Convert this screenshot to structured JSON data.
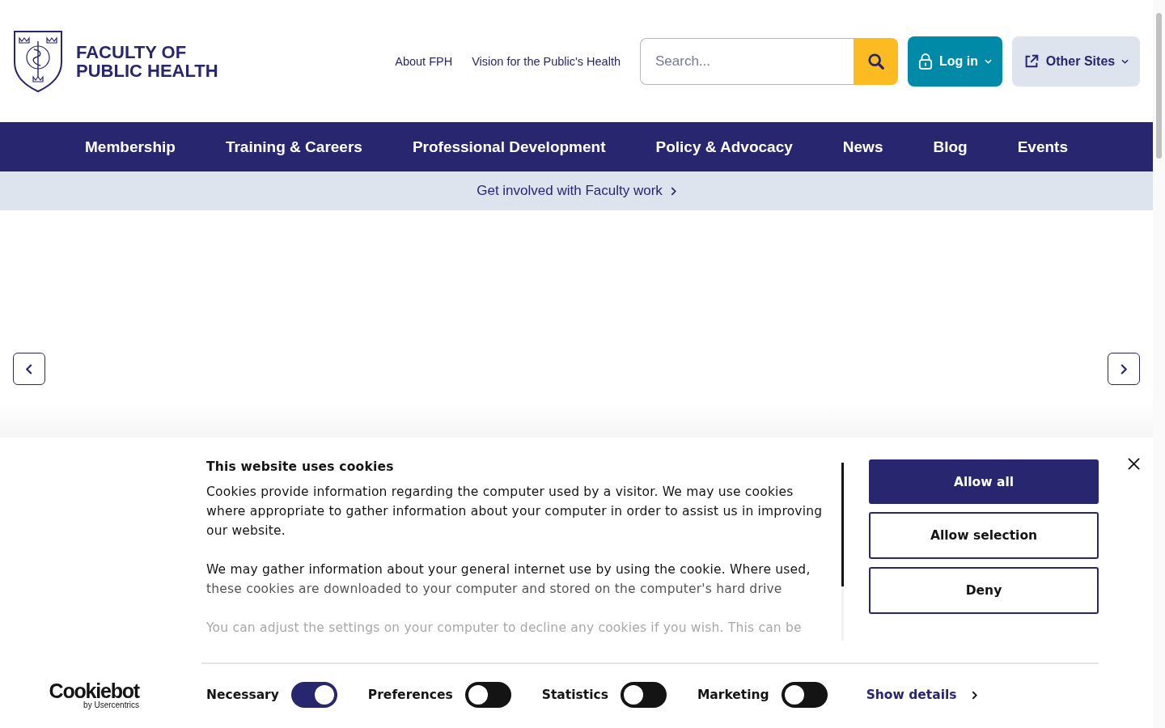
{
  "header": {
    "logo": {
      "line1": "FACULTY OF",
      "line2": "PUBLIC HEALTH"
    },
    "links": [
      "About FPH",
      "Vision for the Public's Health"
    ],
    "search": {
      "placeholder": "Search..."
    },
    "login": {
      "label": "Log in"
    },
    "other_sites": {
      "label": "Other Sites"
    }
  },
  "nav": [
    "Membership",
    "Training & Careers",
    "Professional Development",
    "Policy & Advocacy",
    "News",
    "Blog",
    "Events"
  ],
  "banner": {
    "label": "Get involved with Faculty work"
  },
  "cookie_dialog": {
    "title": "This website uses cookies",
    "paragraphs": [
      {
        "text": "Cookies provide information regarding the computer used by a visitor. We may use cookies where appropriate to gather information about your computer in order to assist us in improving our website.",
        "kind": "normal"
      },
      {
        "text": "We may gather information about your general internet use by using the cookie. Where used,",
        "kind": "normal"
      },
      {
        "text": "these cookies are downloaded to your computer and stored on the computer's hard drive",
        "kind": "dimmed"
      },
      {
        "text": "You can adjust the settings on your computer to decline any cookies if you wish. This can be",
        "kind": "faded"
      }
    ],
    "buttons": [
      {
        "label": "Allow all",
        "kind": "primary"
      },
      {
        "label": "Allow selection",
        "kind": "outline"
      },
      {
        "label": "Deny",
        "kind": "outline"
      }
    ],
    "brand": {
      "name": "Cookiebot",
      "byline": "by Usercentrics"
    },
    "toggles": [
      {
        "label": "Necessary",
        "on": true
      },
      {
        "label": "Preferences",
        "on": false
      },
      {
        "label": "Statistics",
        "on": false
      },
      {
        "label": "Marketing",
        "on": false
      }
    ],
    "details_link": "Show details"
  }
}
